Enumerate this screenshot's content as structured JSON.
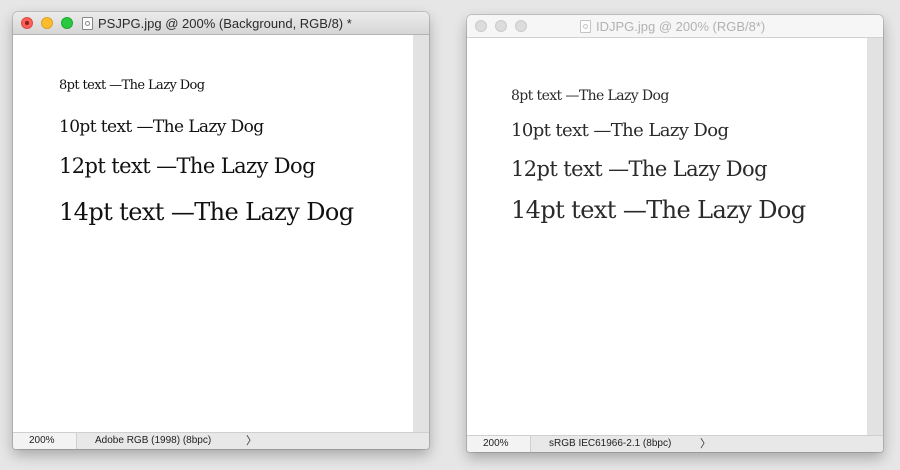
{
  "windows": [
    {
      "title": "PSJPG.jpg @ 200% (Background, RGB/8) *",
      "zoom": "200%",
      "profile": "Adobe RGB (1998) (8bpc)",
      "lines": [
        "8pt text —The Lazy Dog",
        "10pt text —The Lazy Dog",
        "12pt text —The Lazy Dog",
        "14pt text —The Lazy Dog"
      ]
    },
    {
      "title": "IDJPG.jpg @ 200% (RGB/8*)",
      "zoom": "200%",
      "profile": "sRGB IEC61966-2.1 (8bpc)",
      "lines": [
        "8pt text —The Lazy Dog",
        "10pt text —The Lazy Dog",
        "12pt text —The Lazy Dog",
        "14pt text —The Lazy Dog"
      ]
    }
  ],
  "status_arrow": "〉"
}
